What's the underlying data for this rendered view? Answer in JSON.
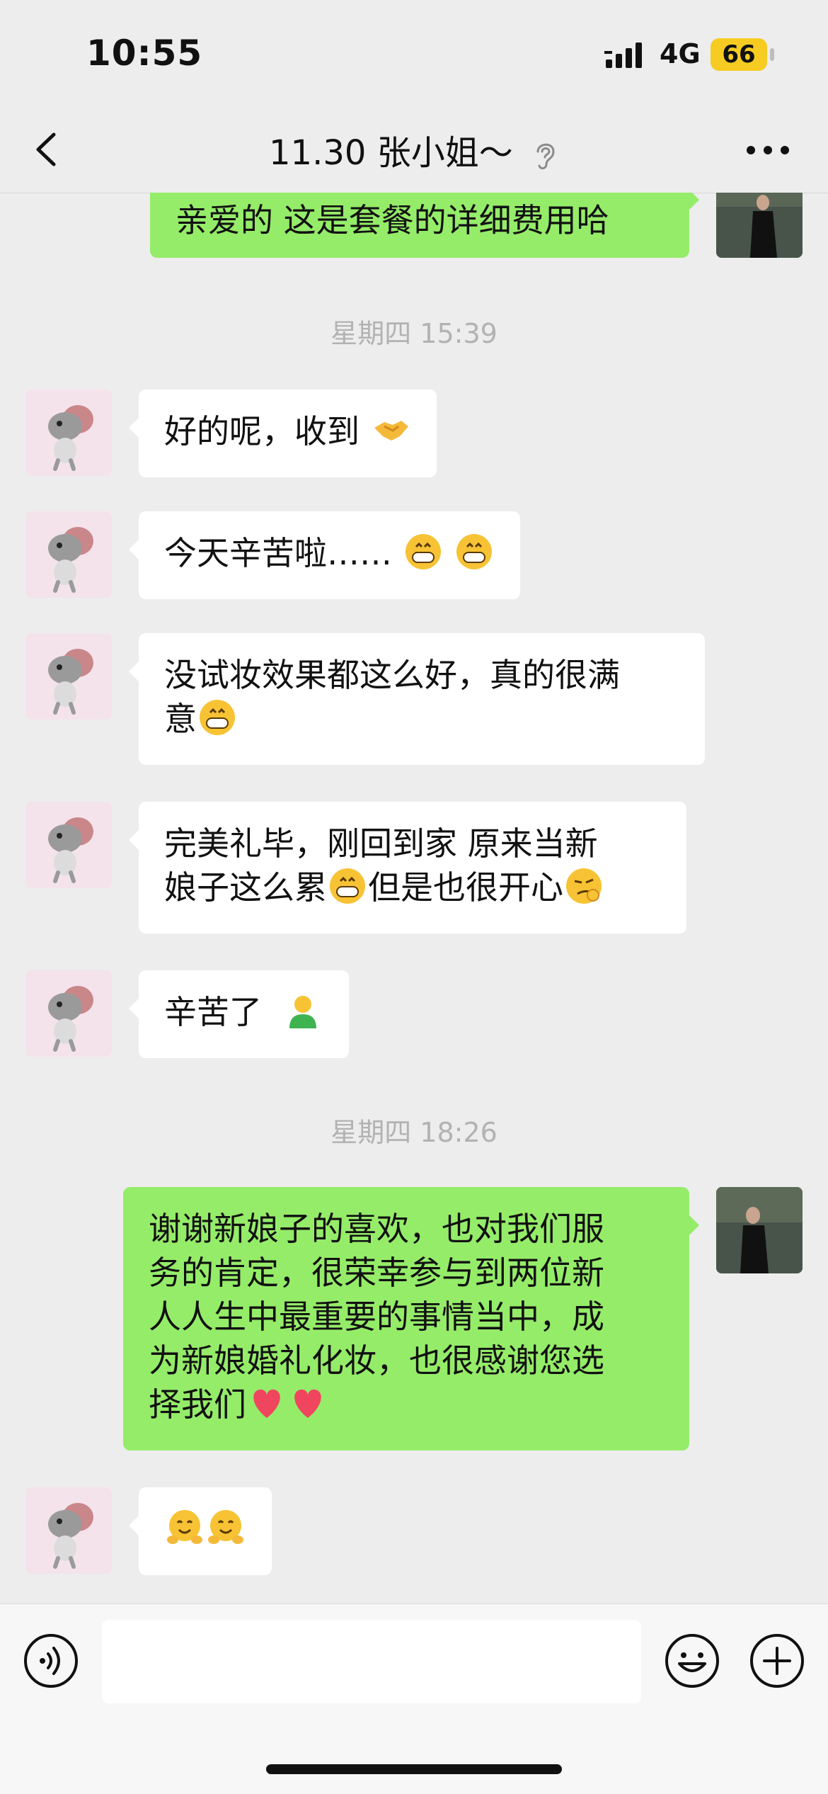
{
  "status_bar": {
    "time": "10:55",
    "network": "4G",
    "battery": "66"
  },
  "header": {
    "title": "11.30 张小姐～"
  },
  "chat": {
    "partial_message": "亲爱的 这是套餐的详细费用哈",
    "timestamps": [
      "星期四 15:39",
      "星期四 18:26"
    ],
    "messages": [
      {
        "text": "好的呢，收到",
        "emoji": [
          "handshake"
        ]
      },
      {
        "text": "今天辛苦啦……",
        "emoji": [
          "grin",
          "grin"
        ]
      },
      {
        "text_line1": "没试妆效果都这么好，真的很满",
        "text_line2": "意",
        "emoji": [
          "grin"
        ]
      },
      {
        "text_line1": "完美礼毕，刚回到家  原来当新",
        "text_line2a": "娘子这么累",
        "text_line2b": "但是也很开心",
        "emoji": [
          "grin",
          "smug"
        ]
      },
      {
        "text": "辛苦了 ",
        "emoji": [
          "green-figure"
        ]
      },
      {
        "outgoing": true,
        "line1": "谢谢新娘子的喜欢，也对我们服",
        "line2": "务的肯定，很荣幸参与到两位新",
        "line3": "人人生中最重要的事情当中，成",
        "line4": "为新娘婚礼化妆，也很感谢您选",
        "line5": "择我们",
        "emoji": [
          "heart",
          "heart"
        ]
      },
      {
        "text": "",
        "emoji": [
          "hug",
          "hug"
        ]
      }
    ]
  },
  "colors": {
    "bubble_out": "#95ec69",
    "bubble_in": "#ffffff",
    "background": "#ededed",
    "battery": "#f7cc22"
  },
  "icons": [
    "back-chevron-icon",
    "ear-icon",
    "more-dots-icon",
    "voice-icon",
    "emoji-face-icon",
    "plus-icon"
  ]
}
